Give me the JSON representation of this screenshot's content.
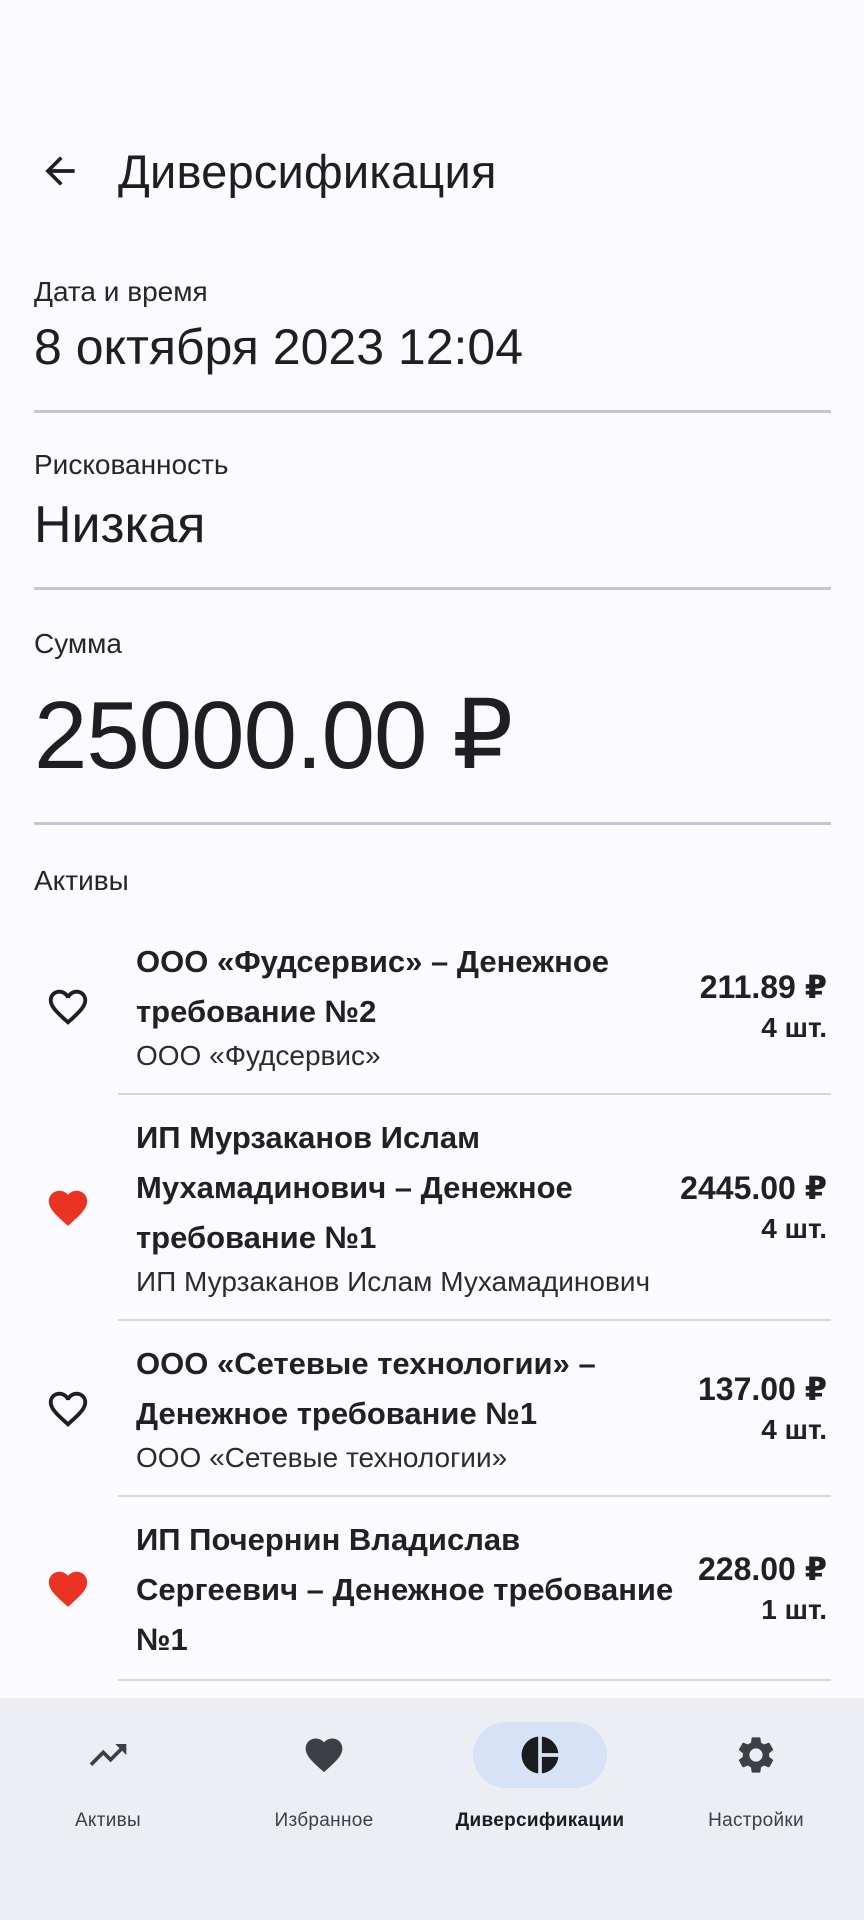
{
  "app_bar": {
    "title": "Диверсификация",
    "back_icon": "arrow-back-icon"
  },
  "fields": {
    "date": {
      "label": "Дата и время",
      "value": "8 октября 2023 12:04"
    },
    "risk": {
      "label": "Рискованность",
      "value": "Низкая"
    },
    "sum": {
      "label": "Сумма",
      "value": "25000.00 ₽"
    }
  },
  "assets": {
    "label": "Активы",
    "items": [
      {
        "title": "ООО «Фудсервис» – Денежное требование №2",
        "issuer": "ООО «Фудсервис»",
        "price": "211.89 ₽",
        "qty": "4 шт.",
        "favorite": false
      },
      {
        "title": "ИП Мурзаканов Ислам Мухамадинович – Денежное требование №1",
        "issuer": "ИП Мурзаканов Ислам Мухамадинович",
        "price": "2445.00 ₽",
        "qty": "4 шт.",
        "favorite": true
      },
      {
        "title": "ООО «Сетевые технологии» – Денежное требование №1",
        "issuer": "ООО «Сетевые технологии»",
        "price": "137.00 ₽",
        "qty": "4 шт.",
        "favorite": false
      },
      {
        "title": "ИП Почернин Владислав Сергеевич – Денежное требование №1",
        "issuer": "",
        "price": "228.00 ₽",
        "qty": "1 шт.",
        "favorite": true
      }
    ]
  },
  "bottom_nav": {
    "items": [
      {
        "label": "Активы",
        "icon": "trending-up-icon",
        "active": false
      },
      {
        "label": "Избранное",
        "icon": "heart-icon",
        "active": false
      },
      {
        "label": "Диверсификации",
        "icon": "pie-chart-icon",
        "active": true
      },
      {
        "label": "Настройки",
        "icon": "gear-icon",
        "active": false
      }
    ]
  },
  "colors": {
    "background": "#fbfbfe",
    "favorite_red": "#ea3323",
    "nav_background": "#eceef4",
    "nav_active_pill": "#d6e2f6",
    "divider": "#c6c7cd"
  }
}
